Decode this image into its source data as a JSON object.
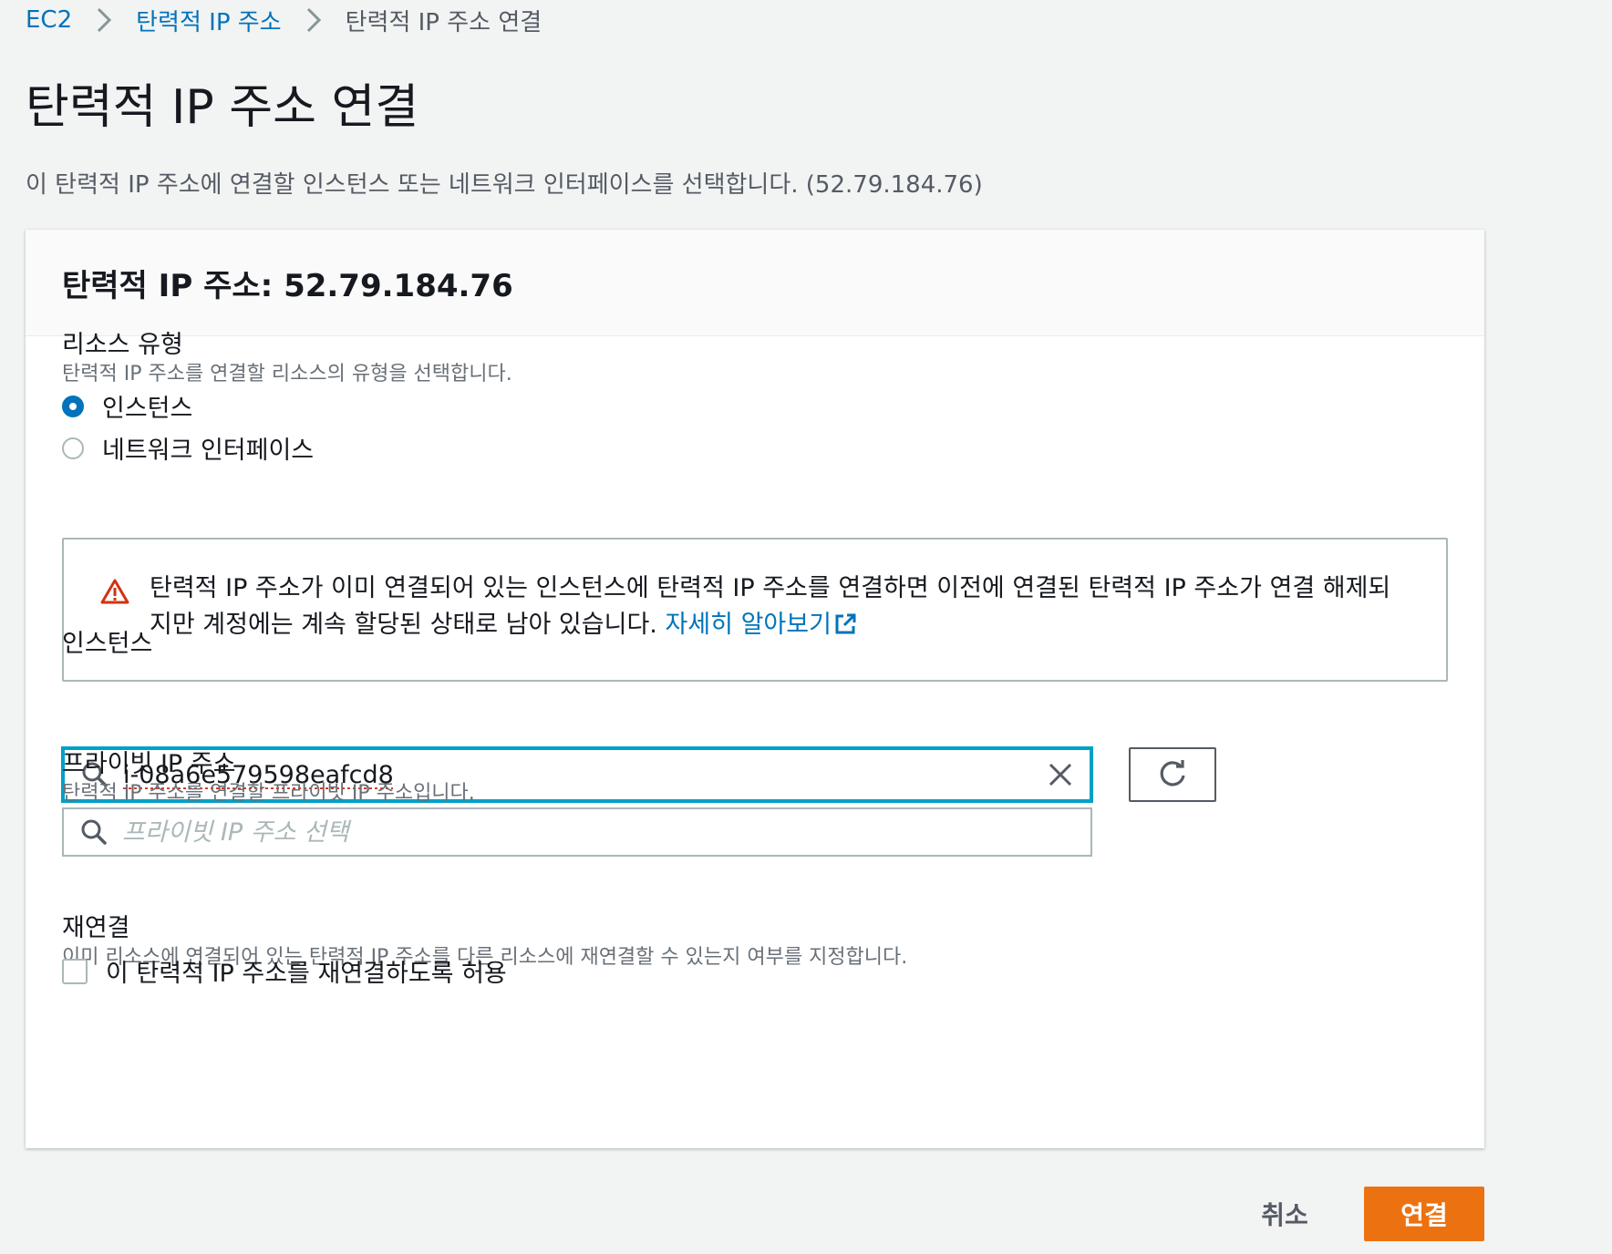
{
  "breadcrumb": {
    "items": [
      "EC2",
      "탄력적 IP 주소",
      "탄력적 IP 주소 연결"
    ]
  },
  "page": {
    "title": "탄력적 IP 주소 연결",
    "description": "이 탄력적 IP 주소에 연결할 인스턴스 또는 네트워크 인터페이스를 선택합니다. (52.79.184.76)"
  },
  "panel": {
    "title": "탄력적 IP 주소: 52.79.184.76",
    "resource_type": {
      "label": "리소스 유형",
      "description": "탄력적 IP 주소를 연결할 리소스의 유형을 선택합니다.",
      "options": [
        {
          "label": "인스턴스",
          "selected": true
        },
        {
          "label": "네트워크 인터페이스",
          "selected": false
        }
      ]
    },
    "alert": {
      "text": "탄력적 IP 주소가 이미 연결되어 있는 인스턴스에 탄력적 IP 주소를 연결하면 이전에 연결된 탄력적 IP 주소가 연결 해제되지만 계정에는 계속 할당된 상태로 남아 있습니다. ",
      "link_label": "자세히 알아보기",
      "icon": "warning-icon",
      "color": "#d13212"
    },
    "instance": {
      "label": "인스턴스",
      "value": "i-08a6e579598eafcd8"
    },
    "private_ip": {
      "label": "프라이빗 IP 주소",
      "description": "탄력적 IP 주소를 연결할 프라이빗 IP 주소입니다.",
      "placeholder": "프라이빗 IP 주소 선택"
    },
    "reassociation": {
      "label": "재연결",
      "description": "이미 리소스에 연결되어 있는 탄력적 IP 주소를 다른 리소스에 재연결할 수 있는지 여부를 지정합니다.",
      "checkbox_label": "이 탄력적 IP 주소를 재연결하도록 허용",
      "checked": false
    }
  },
  "actions": {
    "cancel_label": "취소",
    "associate_label": "연결"
  },
  "colors": {
    "link": "#0073bb",
    "primary": "#ec7211",
    "focus": "#00a1c9"
  }
}
